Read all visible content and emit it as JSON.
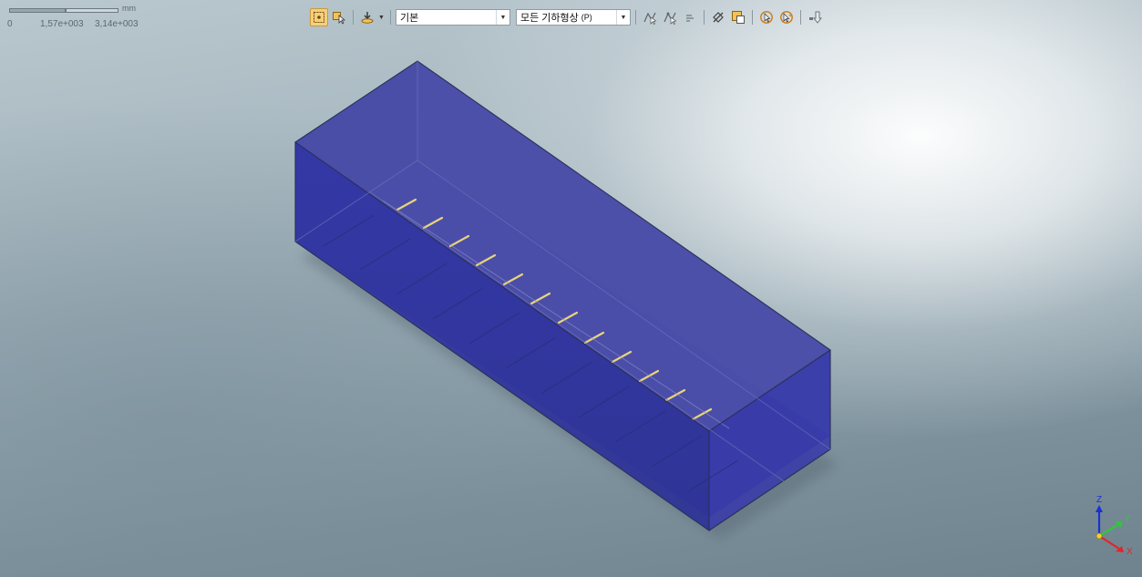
{
  "scale_bar": {
    "unit": "mm",
    "ticks": [
      "0",
      "1,57e+003",
      "3,14e+003"
    ]
  },
  "toolbar": {
    "display_style": "기본",
    "geometry_filter": "모든 기하형상",
    "geometry_filter_hotkey": "(P)"
  },
  "triad": {
    "z": "Z",
    "y": "Y",
    "x": "X"
  },
  "colors": {
    "body": "#3a3ba6",
    "edge": "#2b2f5a",
    "accent": "#f6cf7a"
  }
}
